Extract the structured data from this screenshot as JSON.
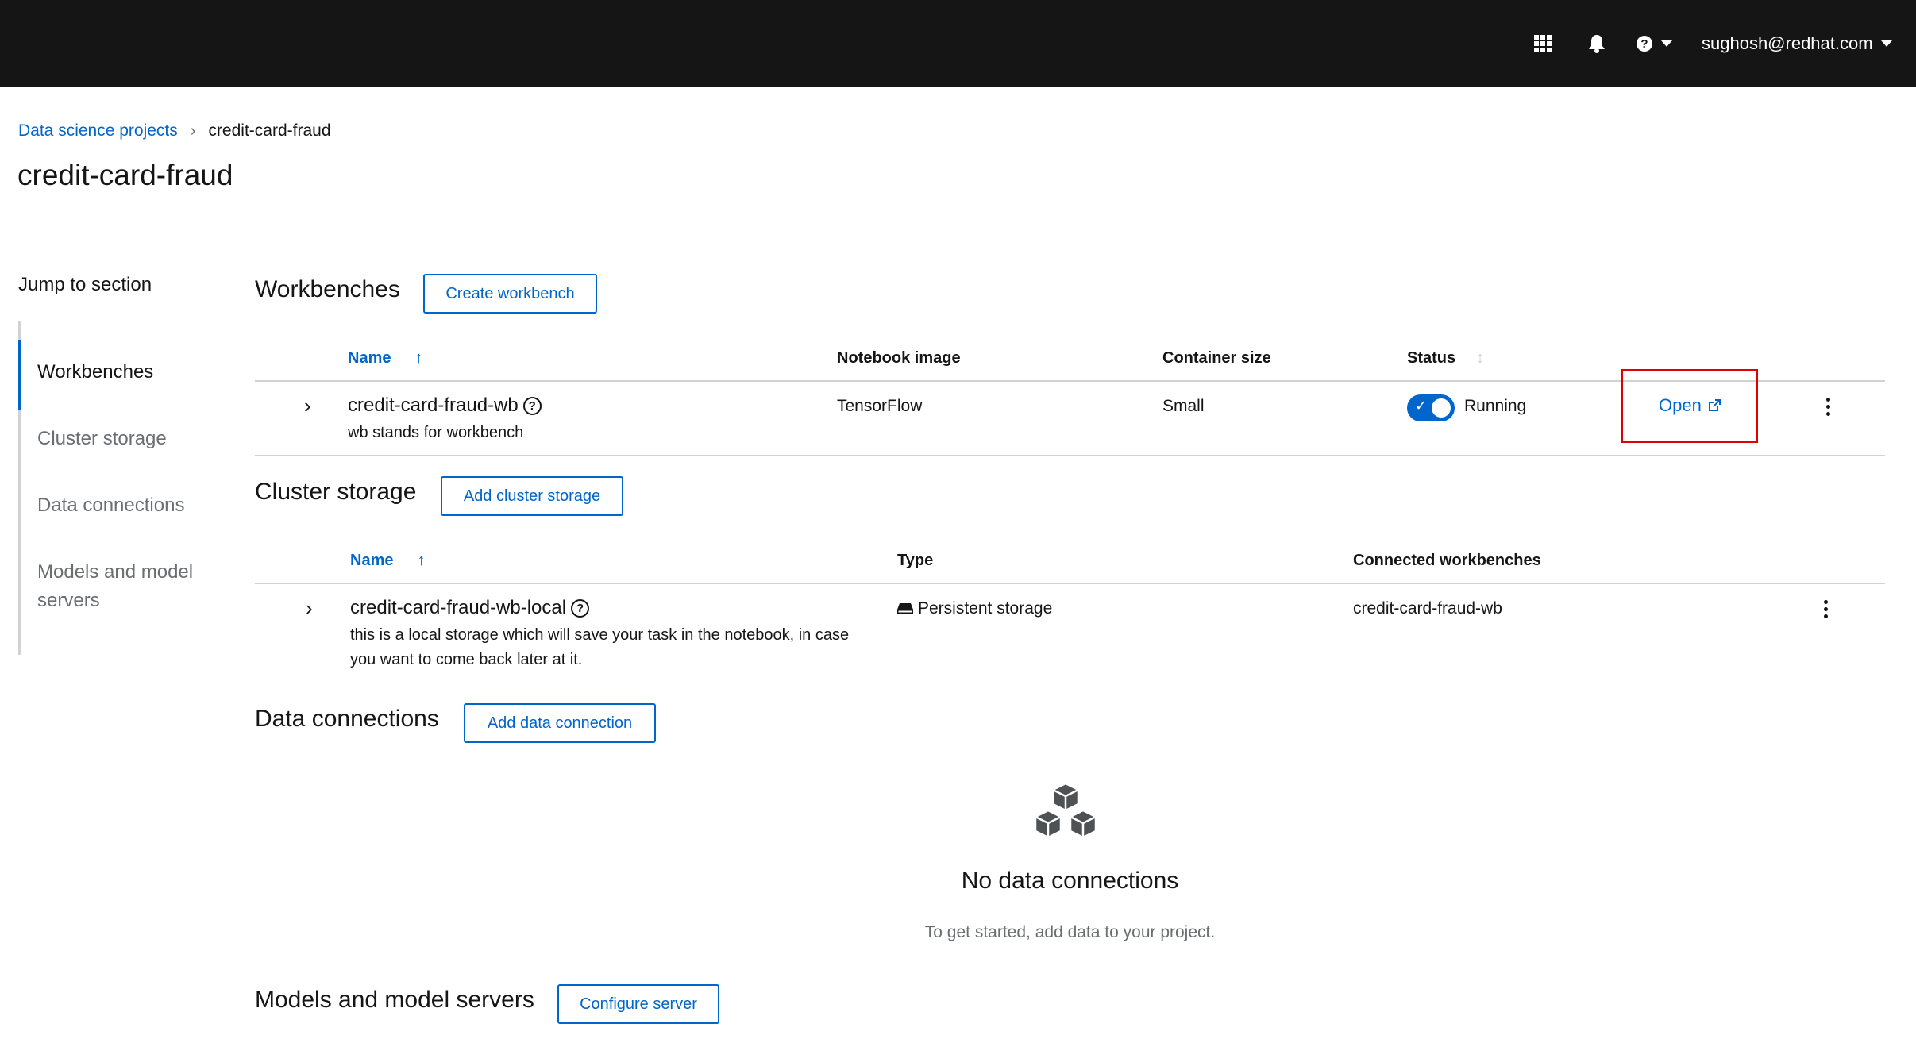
{
  "masthead": {
    "apps_icon": "grid-icon",
    "notifications_icon": "bell-icon",
    "help_icon": "question-circle-icon",
    "user": "sughosh@redhat.com"
  },
  "breadcrumb": {
    "parent": "Data science projects",
    "current": "credit-card-fraud"
  },
  "page_title": "credit-card-fraud",
  "jump_nav": {
    "title": "Jump to section",
    "items": [
      {
        "label": "Workbenches",
        "active": true
      },
      {
        "label": "Cluster storage",
        "active": false
      },
      {
        "label": "Data connections",
        "active": false
      },
      {
        "label": "Models and model",
        "active": false
      },
      {
        "label": "servers",
        "active": false
      }
    ]
  },
  "workbenches": {
    "title": "Workbenches",
    "action": "Create workbench",
    "columns": [
      "Name",
      "Notebook image",
      "Container size",
      "Status"
    ],
    "rows": [
      {
        "name": "credit-card-fraud-wb",
        "description": "wb stands for workbench",
        "image": "TensorFlow",
        "size": "Small",
        "status": "Running",
        "open": "Open"
      }
    ]
  },
  "cluster_storage": {
    "title": "Cluster storage",
    "action": "Add cluster storage",
    "columns": [
      "Name",
      "Type",
      "Connected workbenches"
    ],
    "rows": [
      {
        "name": "credit-card-fraud-wb-local",
        "description_line1": "this is a local storage which will save your task in the notebook, in case",
        "description_line2": "you want to come back later at it.",
        "type": "Persistent storage",
        "connected": "credit-card-fraud-wb"
      }
    ]
  },
  "data_connections": {
    "title": "Data connections",
    "action": "Add data connection",
    "empty_title": "No data connections",
    "empty_body": "To get started, add data to your project."
  },
  "models": {
    "title": "Models and model servers",
    "action": "Configure server"
  },
  "colors": {
    "accent": "#0066cc",
    "masthead": "#151515",
    "highlight": "#e00000"
  }
}
